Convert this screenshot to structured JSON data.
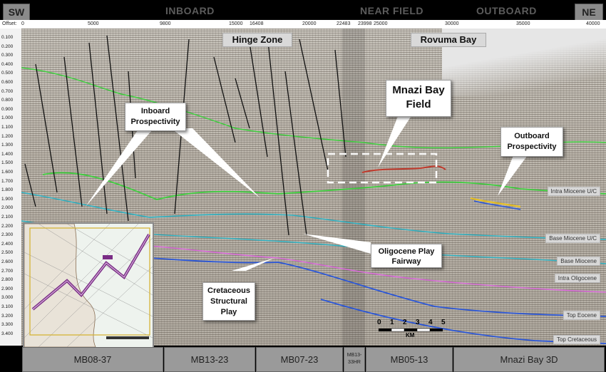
{
  "direction": {
    "left": "SW",
    "right": "NE"
  },
  "regions": [
    {
      "label": "INBOARD"
    },
    {
      "label": "NEAR FIELD"
    },
    {
      "label": "OUTBOARD"
    }
  ],
  "offset": {
    "label": "Offset:",
    "ticks": [
      "0",
      "5000",
      "9800",
      "15000",
      "16408",
      "20000",
      "22483",
      "23998",
      "25000",
      "30000",
      "35000",
      "40000"
    ]
  },
  "depth_ticks": [
    "0.100",
    "0.200",
    "0.300",
    "0.400",
    "0.500",
    "0.600",
    "0.700",
    "0.800",
    "0.900",
    "1.000",
    "1.100",
    "1.200",
    "1.300",
    "1.400",
    "1.500",
    "1.600",
    "1.700",
    "1.800",
    "1.900",
    "2.000",
    "2.100",
    "2.200",
    "2.300",
    "2.400",
    "2.500",
    "2.600",
    "2.700",
    "2.800",
    "2.900",
    "3.000",
    "3.100",
    "3.200",
    "3.300",
    "3.400"
  ],
  "zone_labels": {
    "hinge": "Hinge Zone",
    "rovuma": "Rovuma Bay"
  },
  "callouts": {
    "mnazi": "Mnazi Bay Field",
    "inboard": "Inboard Prospectivity",
    "outboard": "Outboard Prospectivity",
    "oligocene": "Oligocene Play Fairway",
    "cretaceous": "Cretaceous Structural Play"
  },
  "horizons": [
    "Intra Miocene U/C",
    "Base Miocene U/C",
    "Base Miocene",
    "Intra Oligocene",
    "Top Eocene",
    "Top Cretaceous"
  ],
  "scale": {
    "ticks": [
      "0",
      "1",
      "2",
      "3",
      "4",
      "5"
    ],
    "unit": "KM"
  },
  "lines": [
    "MB08-37",
    "MB13-23",
    "MB07-23",
    "MB13-33HR",
    "MB05-13",
    "Mnazi Bay 3D"
  ],
  "colors": {
    "horizon_green": "#3ecf3e",
    "horizon_cyan": "#2fb3c4",
    "horizon_pink": "#d86ad8",
    "horizon_blue": "#2a56d8",
    "fault": "#111111",
    "callout_bg": "#ffffff"
  }
}
